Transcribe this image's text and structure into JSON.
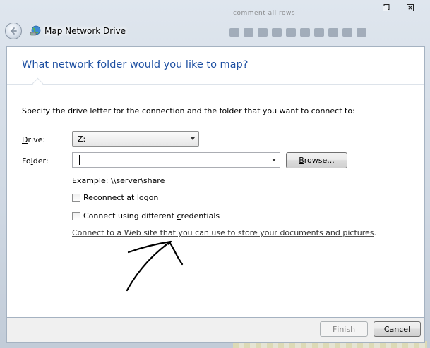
{
  "window": {
    "title": "Map Network Drive",
    "app_icon": "network-drive-icon",
    "back_icon": "back-arrow-icon",
    "restore_icon": "restore-icon",
    "close_icon": "close-icon"
  },
  "background": {
    "doc_text": "comment all rows"
  },
  "dialog": {
    "heading": "What network folder would you like to map?",
    "instruction": "Specify the drive letter for the connection and the folder that you want to connect to:",
    "drive": {
      "label_accel": "D",
      "label_rest": "rive:",
      "value": "Z:"
    },
    "folder": {
      "label_pre": "Fo",
      "label_accel": "l",
      "label_rest": "der:",
      "value": ""
    },
    "browse": {
      "label_accel": "B",
      "label_rest": "rowse..."
    },
    "example": "Example: \\\\server\\share",
    "reconnect": {
      "label_accel": "R",
      "label_rest": "econnect at logon",
      "checked": false
    },
    "credentials": {
      "label_pre": "Connect using different ",
      "label_accel": "c",
      "label_rest": "redentials",
      "checked": false
    },
    "web_link": "Connect to a Web site that you can use to store your documents and pictures",
    "web_link_suffix": "."
  },
  "footer": {
    "finish": {
      "label_accel": "F",
      "label_rest": "inish",
      "enabled": false
    },
    "cancel": "Cancel"
  },
  "colors": {
    "heading": "#1e50a2",
    "content_bg": "#ffffff",
    "footer_bg": "#f0f0f0",
    "annotation": "#000000"
  }
}
